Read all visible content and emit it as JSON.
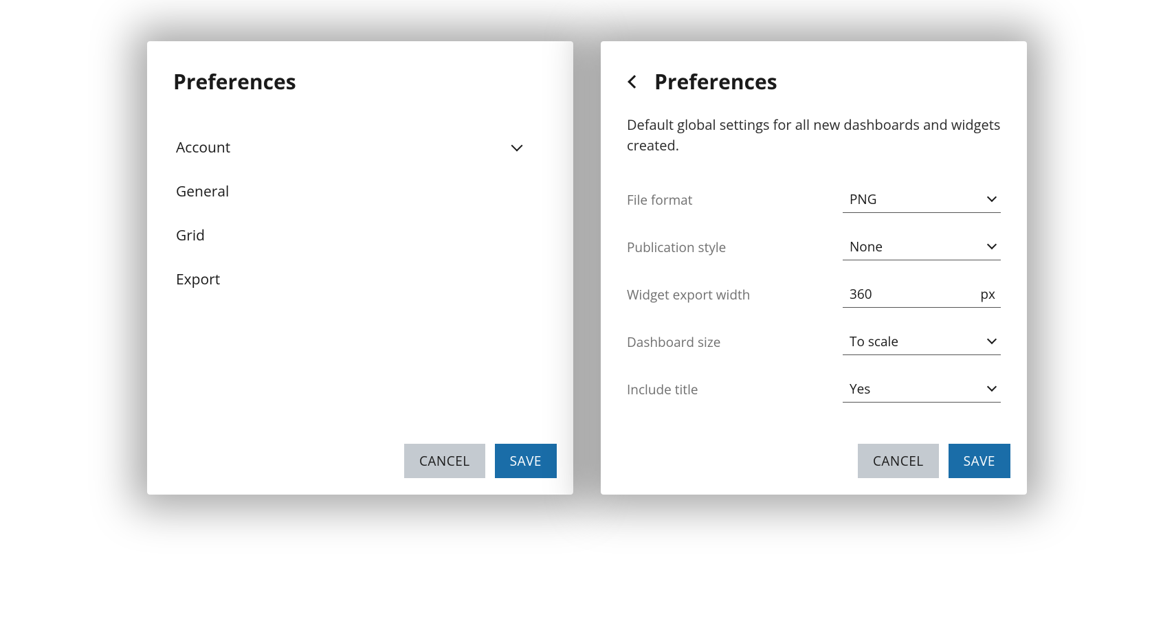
{
  "left": {
    "title": "Preferences",
    "menu": [
      {
        "label": "Account",
        "hasChevron": true,
        "state": "plain"
      },
      {
        "label": "General",
        "hasChevron": false,
        "state": "active"
      },
      {
        "label": "Grid",
        "hasChevron": false,
        "state": "plain"
      },
      {
        "label": "Export",
        "hasChevron": false,
        "state": "secondary"
      }
    ],
    "cancel": "CANCEL",
    "save": "SAVE"
  },
  "right": {
    "title": "Preferences",
    "subtitle": "Default global settings for all new dashboards and widgets created.",
    "fields": {
      "file_format": {
        "label": "File format",
        "value": "PNG"
      },
      "publication_style": {
        "label": "Publication style",
        "value": "None"
      },
      "widget_export_width": {
        "label": "Widget export width",
        "value": "360",
        "suffix": "px"
      },
      "dashboard_size": {
        "label": "Dashboard size",
        "value": "To scale"
      },
      "include_title": {
        "label": "Include title",
        "value": "Yes"
      }
    },
    "cancel": "CANCEL",
    "save": "SAVE"
  }
}
